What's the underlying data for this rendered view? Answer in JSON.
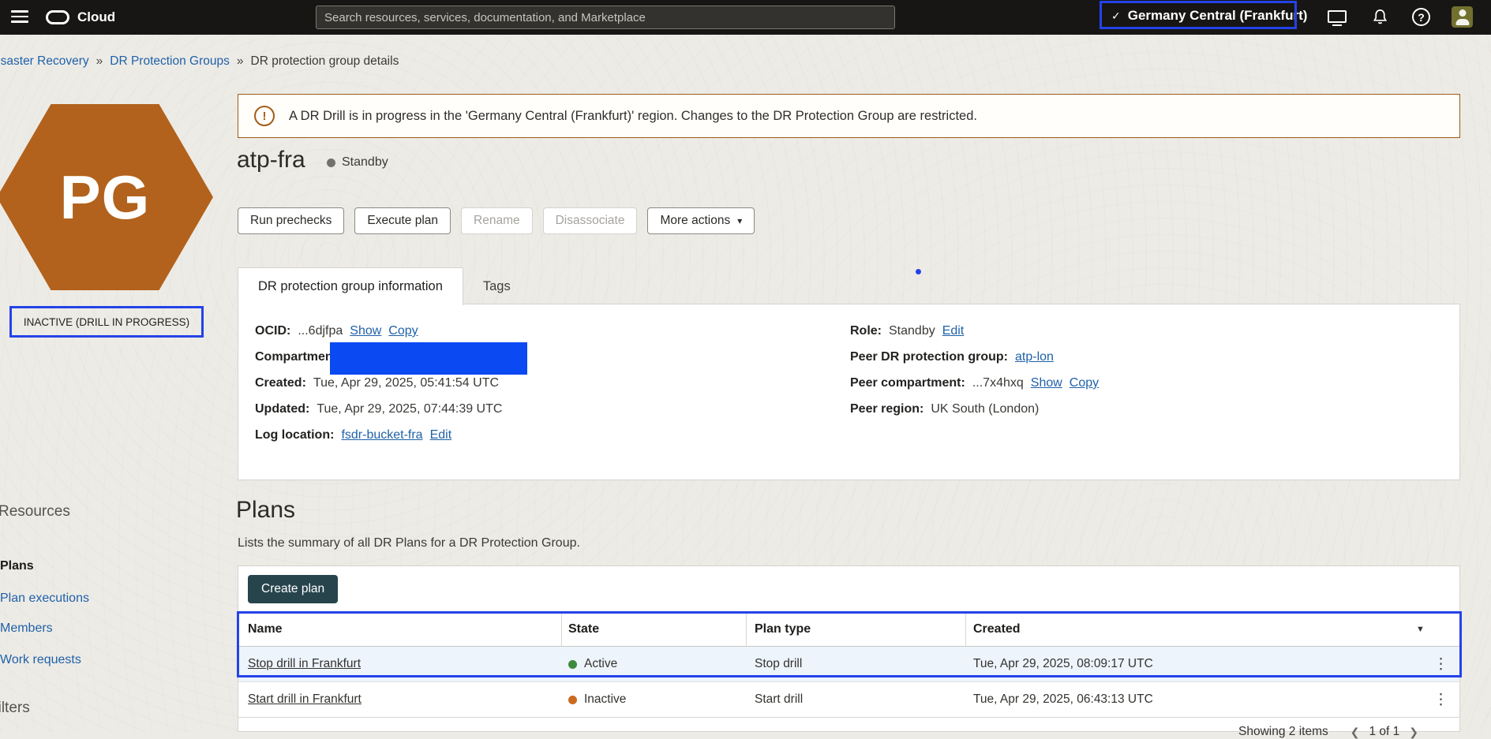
{
  "colors": {
    "annotation_blue": "#2443e8",
    "redaction_blue": "#0b49f2",
    "hexagon_orange": "#b2621c",
    "active_dot_green": "#3e8a3d",
    "inactive_dot_orange": "#ca6a1e",
    "standby_dot_gray": "#73716b",
    "link_blue": "#1f61a8",
    "create_button_dark": "#27444d",
    "warning_border": "#9e5b16",
    "topbar_black": "#171614"
  },
  "icons": {
    "check": "✓",
    "caret_down": "▾",
    "sort_caret": "▼",
    "kebab": "⋮",
    "question": "?",
    "exclamation": "!",
    "chevron_left": "❮",
    "chevron_right": "❯",
    "breadcrumb_sep": "»"
  },
  "topbar": {
    "brand": "Cloud",
    "search_placeholder": "Search resources, services, documentation, and Marketplace",
    "region": "Germany Central (Frankfurt)"
  },
  "breadcrumb": {
    "item1": "Disaster Recovery",
    "item2": "DR Protection Groups",
    "item3": "DR protection group details"
  },
  "banner": {
    "message": "A DR Drill is in progress in the 'Germany Central (Frankfurt)' region. Changes to the DR Protection Group are restricted."
  },
  "entity": {
    "icon_label": "PG",
    "status_badge": "INACTIVE (DRILL IN PROGRESS)",
    "title": "atp-fra",
    "status": "Standby"
  },
  "actions": {
    "run_prechecks": "Run prechecks",
    "execute_plan": "Execute plan",
    "rename": "Rename",
    "disassociate": "Disassociate",
    "more": "More actions"
  },
  "tabs": {
    "info": "DR protection group information",
    "tags": "Tags"
  },
  "details": {
    "ocid_label": "OCID:",
    "ocid_value": "...6djfpa",
    "show": "Show",
    "copy": "Copy",
    "compartment_label": "Compartment:",
    "created_label": "Created:",
    "created_value": "Tue, Apr 29, 2025, 05:41:54 UTC",
    "updated_label": "Updated:",
    "updated_value": "Tue, Apr 29, 2025, 07:44:39 UTC",
    "log_label": "Log location:",
    "log_value": "fsdr-bucket-fra",
    "edit": "Edit",
    "role_label": "Role:",
    "role_value": "Standby",
    "peer_group_label": "Peer DR protection group:",
    "peer_group_value": "atp-lon",
    "peer_comp_label": "Peer compartment:",
    "peer_comp_value": "...7x4hxq",
    "peer_region_label": "Peer region:",
    "peer_region_value": "UK South (London)"
  },
  "plans": {
    "title": "Plans",
    "subtitle": "Lists the summary of all DR Plans for a DR Protection Group.",
    "create_button": "Create plan",
    "columns": {
      "name": "Name",
      "state": "State",
      "type": "Plan type",
      "created": "Created"
    },
    "rows": [
      {
        "name": "Stop drill in Frankfurt",
        "state": "Active",
        "type": "Stop drill",
        "created": "Tue, Apr 29, 2025, 08:09:17 UTC"
      },
      {
        "name": "Start drill in Frankfurt",
        "state": "Inactive",
        "type": "Start drill",
        "created": "Tue, Apr 29, 2025, 06:43:13 UTC"
      }
    ],
    "footer": {
      "showing": "Showing 2 items",
      "page": "1 of 1"
    }
  },
  "sidebar": {
    "resources_title": "Resources",
    "items": [
      {
        "label": "Plans"
      },
      {
        "label": "Plan executions"
      },
      {
        "label": "Members"
      },
      {
        "label": "Work requests"
      }
    ],
    "filters_title": "Filters"
  }
}
